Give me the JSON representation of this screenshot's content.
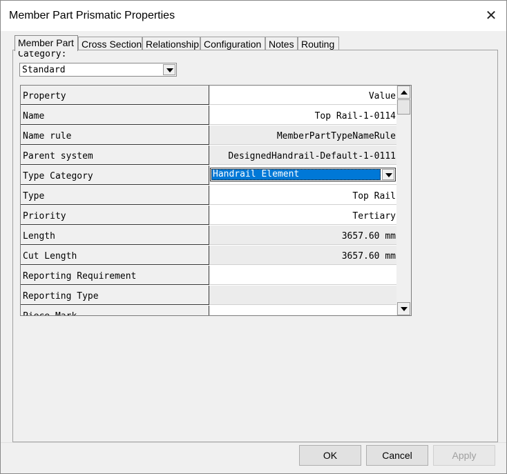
{
  "window": {
    "title": "Member Part Prismatic Properties",
    "close_glyph": "✕"
  },
  "tabs": [
    {
      "label": "Member Part",
      "active": true
    },
    {
      "label": "Cross Section",
      "active": false
    },
    {
      "label": "Relationship",
      "active": false
    },
    {
      "label": "Configuration",
      "active": false
    },
    {
      "label": "Notes",
      "active": false
    },
    {
      "label": "Routing",
      "active": false
    }
  ],
  "category": {
    "label": "Category:",
    "value": "Standard"
  },
  "grid": {
    "headers": {
      "property": "Property",
      "value": "Value"
    },
    "rows": [
      {
        "property": "Name",
        "value": "Top Rail-1-0114",
        "style": "white"
      },
      {
        "property": "Name rule",
        "value": "MemberPartTypeNameRule",
        "style": "gray"
      },
      {
        "property": "Parent system",
        "value": "DesignedHandrail-Default-1-0111",
        "style": "gray"
      },
      {
        "property": "Type Category",
        "value": "Handrail Element",
        "style": "combo"
      },
      {
        "property": "Type",
        "value": "Top Rail",
        "style": "white"
      },
      {
        "property": "Priority",
        "value": "Tertiary",
        "style": "white"
      },
      {
        "property": "Length",
        "value": "3657.60 mm",
        "style": "gray"
      },
      {
        "property": "Cut Length",
        "value": "3657.60 mm",
        "style": "gray"
      },
      {
        "property": "Reporting Requirement",
        "value": "",
        "style": "white"
      },
      {
        "property": "Reporting Type",
        "value": "",
        "style": "gray"
      },
      {
        "property": "Piece Mark",
        "value": "",
        "style": "white"
      }
    ]
  },
  "buttons": {
    "ok": "OK",
    "cancel": "Cancel",
    "apply": "Apply"
  }
}
